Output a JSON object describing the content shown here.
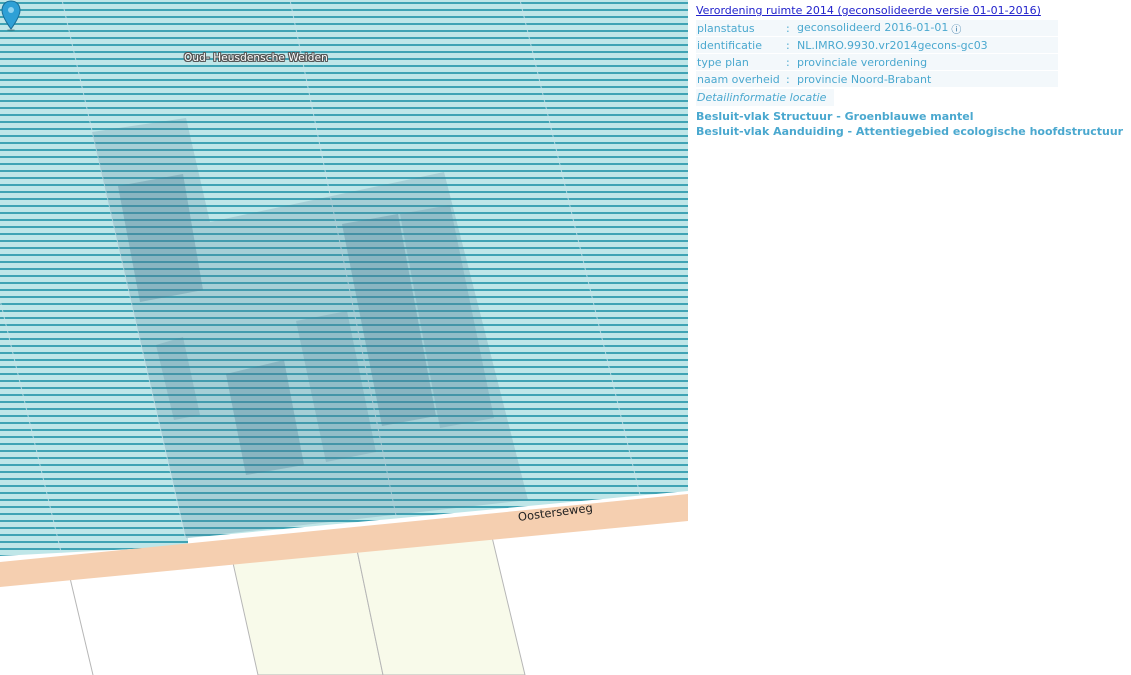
{
  "map": {
    "place_label": "Oud- Heusdensche Weiden",
    "road_label": "Oosterseweg",
    "marker_icon": "location-pin-icon",
    "colors": {
      "hatch_line": "#3fa3b4",
      "hatch_bg": "#bfe6e8",
      "darker_block": "#7ea3b0",
      "road": "#f5cfb0",
      "parcel_yellow": "#f8faea",
      "parcel_border": "#b6b6b6",
      "marker": "#2ea0d6"
    }
  },
  "info": {
    "plan_title": "Verordening ruimte 2014 (geconsolideerde versie 01-01-2016)",
    "properties": [
      {
        "key": "planstatus",
        "sep": ":",
        "value": "geconsolideerd 2016-01-01",
        "has_info_icon": true
      },
      {
        "key": "identificatie",
        "sep": ":",
        "value": "NL.IMRO.9930.vr2014gecons-gc03",
        "has_info_icon": false
      },
      {
        "key": "type plan",
        "sep": ":",
        "value": "provinciale verordening",
        "has_info_icon": false
      },
      {
        "key": "naam overheid",
        "sep": ":",
        "value": "provincie Noord-Brabant",
        "has_info_icon": false
      }
    ],
    "info_icon_glyph": "ⓘ",
    "detail_link": "Detailinformatie locatie",
    "besluit_items": [
      "Besluit-vlak Structuur - Groenblauwe mantel",
      "Besluit-vlak Aanduiding - Attentiegebied ecologische hoofdstructuur"
    ],
    "colors": {
      "link": "#2222cc",
      "text": "#4aa8cf",
      "row_bg": "#f3f8fb"
    }
  }
}
